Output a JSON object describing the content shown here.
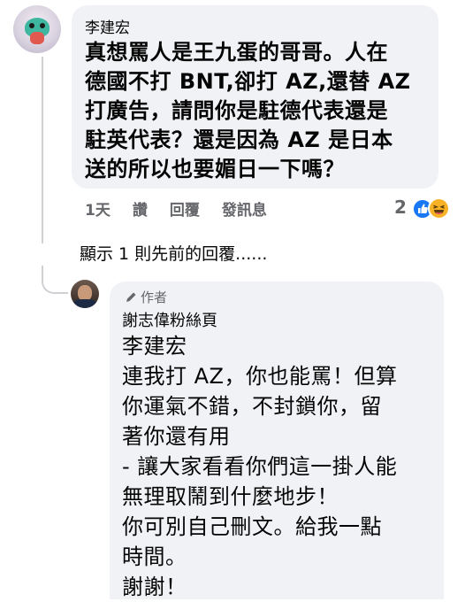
{
  "comment": {
    "author": "李建宏",
    "text_lines": [
      "真想罵人是王九蛋的哥哥。人在",
      "德國不打 BNT,卻打 AZ,還替 AZ",
      "打廣告，請問你是駐德代表還是",
      "駐英代表？還是因為 AZ 是日本",
      "送的所以也要媚日一下嗎？"
    ],
    "time": "1天",
    "like_label": "讚",
    "reply_label": "回覆",
    "message_label": "發訊息",
    "reaction_count": "2",
    "reactions": [
      "like-icon",
      "haha-icon"
    ],
    "colors": {
      "like": "#1877f2",
      "haha": "#f7b125"
    }
  },
  "show_previous": "顯示 1 則先前的回覆......",
  "reply": {
    "badge": "作者",
    "author": "謝志偉粉絲頁",
    "lines": [
      "李建宏",
      "連我打 AZ，你也能罵！但算",
      "你運氣不錯，不封鎖你，留",
      "著你還有用",
      "- 讓大家看看你們這一掛人能",
      "無理取鬧到什麼地步！",
      "你可別自己刪文。給我一點",
      "時間。",
      "謝謝！"
    ]
  }
}
